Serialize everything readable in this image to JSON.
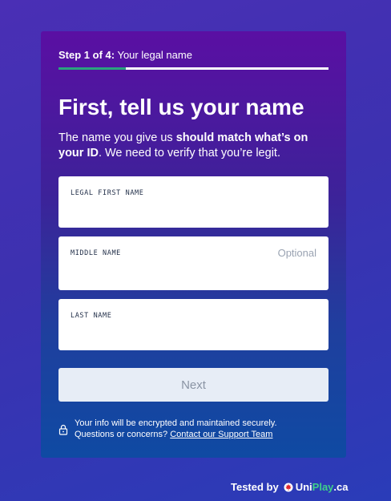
{
  "step": {
    "prefix": "Step 1 of 4:",
    "title": "Your legal name",
    "progress_fraction": 0.25
  },
  "heading": "First, tell us your name",
  "intro": {
    "part1": "The name you give us ",
    "bold": "should match what’s on your ID",
    "part2": ". We need to verify that you’re legit."
  },
  "fields": {
    "first_name": {
      "label": "LEGAL FIRST NAME",
      "value": ""
    },
    "middle_name": {
      "label": "MIDDLE NAME",
      "value": "",
      "optional_hint": "Optional"
    },
    "last_name": {
      "label": "LAST NAME",
      "value": ""
    }
  },
  "next_button": "Next",
  "security": {
    "line1": "Your info will be encrypted and maintained securely.",
    "line2": "Questions or concerns? ",
    "link": "Contact our Support Team",
    "icon": "lock-icon"
  },
  "footer": {
    "tested_by": "Tested by",
    "brand_uni": "Uni",
    "brand_play": "Play",
    "brand_ca": ".ca",
    "icon": "maple-leaf-icon"
  },
  "colors": {
    "progress_fill": "#2aa37e",
    "brand_accent": "#3fd08a",
    "leaf": "#e0242e"
  }
}
